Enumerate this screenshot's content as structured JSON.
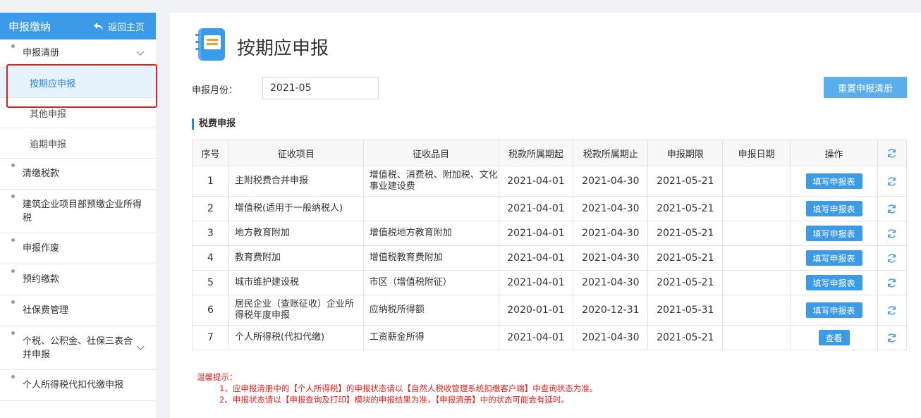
{
  "sidebar": {
    "title": "申报缴纳",
    "back_label": "返回主页",
    "items": [
      {
        "label": "申报清册",
        "expandable": true,
        "children": [
          "按期应申报",
          "其他申报",
          "逾期申报"
        ]
      },
      {
        "label": "清缴税款"
      },
      {
        "label": "建筑企业项目部预缴企业所得税"
      },
      {
        "label": "申报作废"
      },
      {
        "label": "预约缴款"
      },
      {
        "label": "社保费管理"
      },
      {
        "label": "个税、公积金、社保三表合并申报",
        "expandable": true
      },
      {
        "label": "个人所得税代扣代缴申报"
      }
    ],
    "active_sub": "按期应申报"
  },
  "main": {
    "title": "按期应申报",
    "month_label": "申报月份：",
    "month_value": "2021-05",
    "reset_button": "重置申报清册",
    "section_title": "税费申报",
    "table": {
      "headers": [
        "序号",
        "征收项目",
        "征收品目",
        "税款所属期起",
        "税款所属期止",
        "申报期限",
        "申报日期",
        "操作"
      ],
      "rows": [
        {
          "no": "1",
          "item": "主附税费合并申报",
          "category": "增值税、消费税、附加税、文化事业建设费",
          "start": "2021-04-01",
          "end": "2021-04-30",
          "deadline": "2021-05-21",
          "date": "",
          "action": "填写申报表"
        },
        {
          "no": "2",
          "item": "增值税(适用于一般纳税人)",
          "category": "",
          "start": "2021-04-01",
          "end": "2021-04-30",
          "deadline": "2021-05-21",
          "date": "",
          "action": "填写申报表"
        },
        {
          "no": "3",
          "item": "地方教育附加",
          "category": "增值税地方教育附加",
          "start": "2021-04-01",
          "end": "2021-04-30",
          "deadline": "2021-05-21",
          "date": "",
          "action": "填写申报表"
        },
        {
          "no": "4",
          "item": "教育费附加",
          "category": "增值税教育费附加",
          "start": "2021-04-01",
          "end": "2021-04-30",
          "deadline": "2021-05-21",
          "date": "",
          "action": "填写申报表"
        },
        {
          "no": "5",
          "item": "城市维护建设税",
          "category": "市区（增值税附征）",
          "start": "2021-04-01",
          "end": "2021-04-30",
          "deadline": "2021-05-21",
          "date": "",
          "action": "填写申报表"
        },
        {
          "no": "6",
          "item": "居民企业（查账征收）企业所得税年度申报",
          "category": "应纳税所得额",
          "start": "2020-01-01",
          "end": "2020-12-31",
          "deadline": "2021-05-31",
          "date": "",
          "action": "填写申报表"
        },
        {
          "no": "7",
          "item": "个人所得税(代扣代缴)",
          "category": "工资薪金所得",
          "start": "2021-04-01",
          "end": "2021-04-30",
          "deadline": "2021-05-21",
          "date": "",
          "action": "查看"
        }
      ]
    },
    "tips": {
      "heading": "温馨提示：",
      "lines": [
        "1、应申报清册中的【个人所得税】的申报状态请以【自然人税收管理系统扣缴客户端】中查询状态为准。",
        "2、申报状态请以【申报查询及打印】模块的申报结果为准，【申报清册】中的状态可能会有延时。"
      ]
    }
  },
  "colors": {
    "accent": "#3c9be8",
    "alert": "#e02020"
  },
  "icons": [
    "back-arrow-icon",
    "chevron-down-icon",
    "document-icon",
    "refresh-icon"
  ]
}
